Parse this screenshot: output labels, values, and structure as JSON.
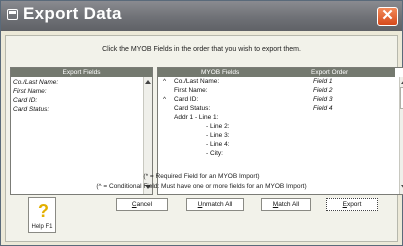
{
  "window": {
    "title": "Export Data",
    "close_symbol": "✕"
  },
  "instruction": "Click the MYOB Fields in the order that you wish to export them.",
  "export_fields": {
    "header": "Export Fields",
    "items": [
      "Co./Last Name:",
      "First Name:",
      "Card ID:",
      "Card Status:"
    ]
  },
  "myob_fields": {
    "header_fields": "MYOB Fields",
    "header_order": "Export Order",
    "rows": [
      {
        "marker": "^",
        "name": "Co./Last Name:",
        "order": "Field 1"
      },
      {
        "marker": "",
        "name": "First Name:",
        "order": "Field 2"
      },
      {
        "marker": "^",
        "name": "Card ID:",
        "order": "Field 3"
      },
      {
        "marker": "",
        "name": "Card Status:",
        "order": "Field 4"
      },
      {
        "marker": "",
        "name": "Addr 1 - Line 1:",
        "order": ""
      },
      {
        "marker": "",
        "name": "- Line 2:",
        "order": ""
      },
      {
        "marker": "",
        "name": "- Line 3:",
        "order": ""
      },
      {
        "marker": "",
        "name": "- Line 4:",
        "order": ""
      },
      {
        "marker": "",
        "name": "- City:",
        "order": ""
      }
    ]
  },
  "notes": {
    "required": "(* = Required Field for an MYOB Import)",
    "conditional": "(^ = Conditional Field: Must have one or more fields for an MYOB Import)"
  },
  "buttons": {
    "cancel": {
      "mnemonic": "C",
      "rest": "ancel"
    },
    "unmatch_all": {
      "mnemonic": "U",
      "rest": "nmatch All"
    },
    "match_all": {
      "mnemonic": "M",
      "rest": "atch All"
    },
    "export": {
      "mnemonic": "E",
      "rest": "xport"
    }
  },
  "help": {
    "symbol": "?",
    "label": "Help F1"
  },
  "colors": {
    "titlebar": "#6f7176",
    "close": "#e0602a",
    "list_header": "#74796f",
    "help_icon": "#e3b000"
  }
}
